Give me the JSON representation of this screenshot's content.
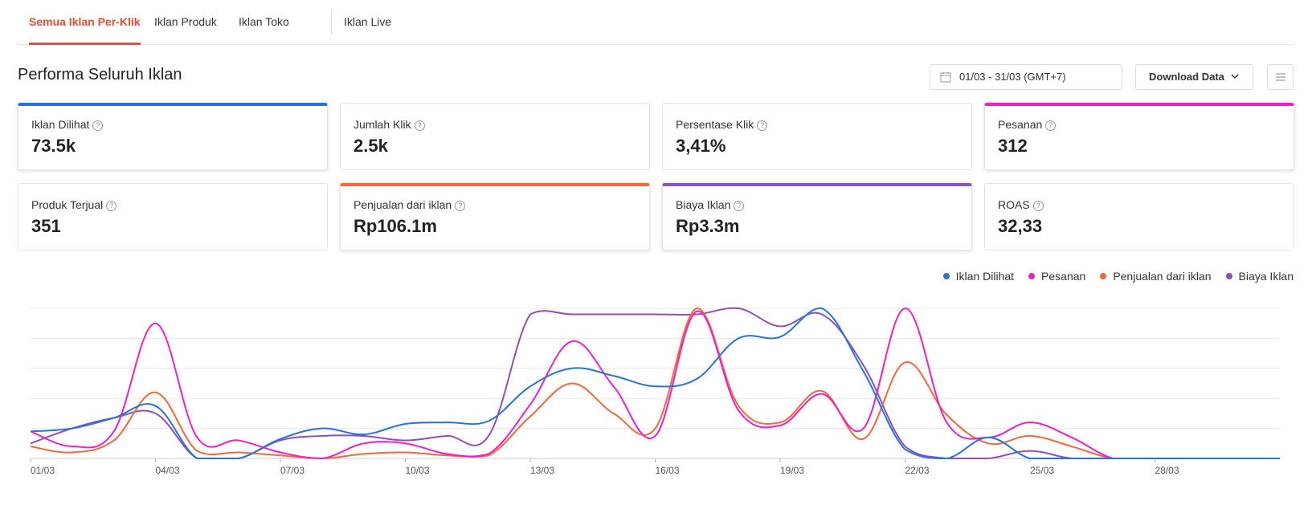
{
  "tabs": [
    {
      "label": "Semua Iklan Per-Klik",
      "active": true
    },
    {
      "label": "Iklan Produk",
      "active": false
    },
    {
      "label": "Iklan Toko",
      "active": false
    },
    {
      "label": "Iklan Live",
      "active": false
    }
  ],
  "header": {
    "title": "Performa Seluruh Iklan",
    "date_range": "01/03 - 31/03 (GMT+7)",
    "download_label": "Download Data"
  },
  "metrics": [
    {
      "label": "Iklan Dilihat",
      "value": "73.5k",
      "selected": true,
      "color": "#2673dd"
    },
    {
      "label": "Jumlah Klik",
      "value": "2.5k",
      "selected": false
    },
    {
      "label": "Persentase Klik",
      "value": "3,41%",
      "selected": false
    },
    {
      "label": "Pesanan",
      "value": "312",
      "selected": true,
      "color": "#f020c8"
    },
    {
      "label": "Produk Terjual",
      "value": "351",
      "selected": false
    },
    {
      "label": "Penjualan dari iklan",
      "value": "Rp106.1m",
      "selected": true,
      "color": "#f3683a"
    },
    {
      "label": "Biaya Iklan",
      "value": "Rp3.3m",
      "selected": true,
      "color": "#8e4fc0"
    },
    {
      "label": "ROAS",
      "value": "32,33",
      "selected": false
    }
  ],
  "chart_data": {
    "type": "line",
    "x": [
      "01/03",
      "02/03",
      "03/03",
      "04/03",
      "05/03",
      "06/03",
      "07/03",
      "08/03",
      "09/03",
      "10/03",
      "11/03",
      "12/03",
      "13/03",
      "14/03",
      "15/03",
      "16/03",
      "17/03",
      "18/03",
      "19/03",
      "20/03",
      "21/03",
      "22/03",
      "23/03",
      "24/03",
      "25/03",
      "26/03",
      "27/03",
      "28/03",
      "29/03",
      "30/03",
      "31/03"
    ],
    "tick_labels": [
      "01/03",
      "04/03",
      "07/03",
      "10/03",
      "13/03",
      "16/03",
      "19/03",
      "22/03",
      "25/03",
      "28/03"
    ],
    "ylim": [
      0,
      100
    ],
    "grid": true,
    "legend_position": "top-right",
    "series": [
      {
        "name": "Iklan Dilihat",
        "color": "#2673dd",
        "values": [
          18,
          20,
          27,
          35,
          0,
          0,
          13,
          20,
          16,
          23,
          24,
          25,
          48,
          60,
          55,
          48,
          53,
          80,
          81,
          100,
          58,
          6,
          0,
          14,
          0,
          0,
          0,
          0,
          0,
          0,
          0
        ]
      },
      {
        "name": "Pesanan",
        "color": "#f020c8",
        "values": [
          18,
          8,
          18,
          90,
          14,
          12,
          4,
          0,
          10,
          10,
          3,
          3,
          36,
          78,
          48,
          15,
          98,
          32,
          22,
          43,
          20,
          100,
          24,
          14,
          24,
          14,
          0,
          0,
          0,
          0,
          0
        ]
      },
      {
        "name": "Penjualan dari iklan",
        "color": "#f3683a",
        "values": [
          8,
          4,
          12,
          44,
          5,
          4,
          2,
          0,
          3,
          4,
          2,
          2,
          28,
          50,
          30,
          20,
          100,
          35,
          24,
          45,
          13,
          64,
          29,
          10,
          15,
          8,
          0,
          0,
          0,
          0,
          0
        ]
      },
      {
        "name": "Biaya Iklan",
        "color": "#8e4fc0",
        "values": [
          10,
          20,
          27,
          30,
          0,
          0,
          12,
          15,
          15,
          12,
          15,
          15,
          96,
          96,
          96,
          96,
          96,
          100,
          88,
          96,
          62,
          8,
          0,
          0,
          5,
          0,
          0,
          0,
          0,
          0,
          0
        ]
      }
    ]
  }
}
